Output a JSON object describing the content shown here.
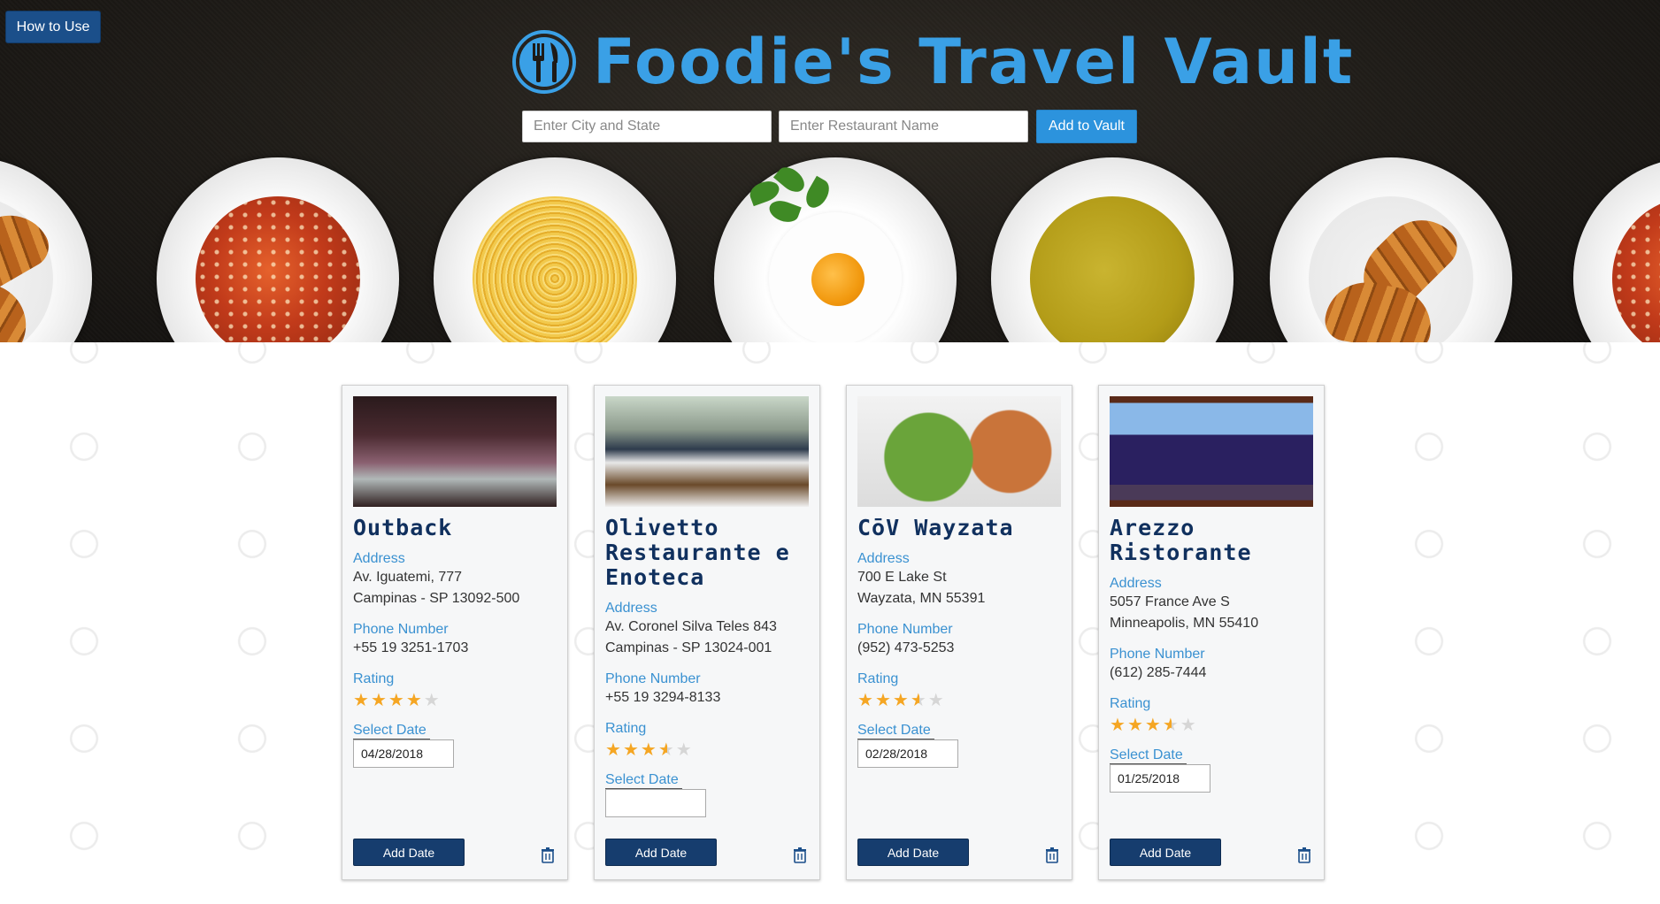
{
  "header": {
    "how_to_use": "How to Use",
    "title": "Foodie's Travel Vault",
    "city_placeholder": "Enter City and State",
    "restaurant_placeholder": "Enter Restaurant Name",
    "add_button": "Add to Vault"
  },
  "labels": {
    "address": "Address",
    "phone": "Phone Number",
    "rating": "Rating",
    "select_date": "Select Date",
    "add_date": "Add Date"
  },
  "cards": [
    {
      "name": "Outback",
      "address_line1": "Av. Iguatemi, 777",
      "address_line2": "Campinas - SP 13092-500",
      "phone": "+55 19 3251-1703",
      "rating": 4,
      "date": "04/28/2018"
    },
    {
      "name": "Olivetto Restaurante e Enoteca",
      "address_line1": "Av. Coronel Silva Teles 843",
      "address_line2": "Campinas - SP 13024-001",
      "phone": "+55 19 3294-8133",
      "rating": 3.5,
      "date": ""
    },
    {
      "name": "CōV Wayzata",
      "address_line1": "700 E Lake St",
      "address_line2": "Wayzata, MN 55391",
      "phone": "(952) 473-5253",
      "rating": 3.5,
      "date": "02/28/2018"
    },
    {
      "name": "Arezzo Ristorante",
      "address_line1": "5057 France Ave S",
      "address_line2": "Minneapolis, MN 55410",
      "phone": "(612) 285-7444",
      "rating": 3.5,
      "date": "01/25/2018"
    }
  ],
  "icons": {
    "logo": "fork-knife-icon",
    "delete": "trash-icon",
    "star": "star-icon"
  },
  "colors": {
    "brand_blue": "#3aa0e6",
    "navy": "#163d6e",
    "label_blue": "#3a91d1",
    "star": "#f5a623"
  }
}
